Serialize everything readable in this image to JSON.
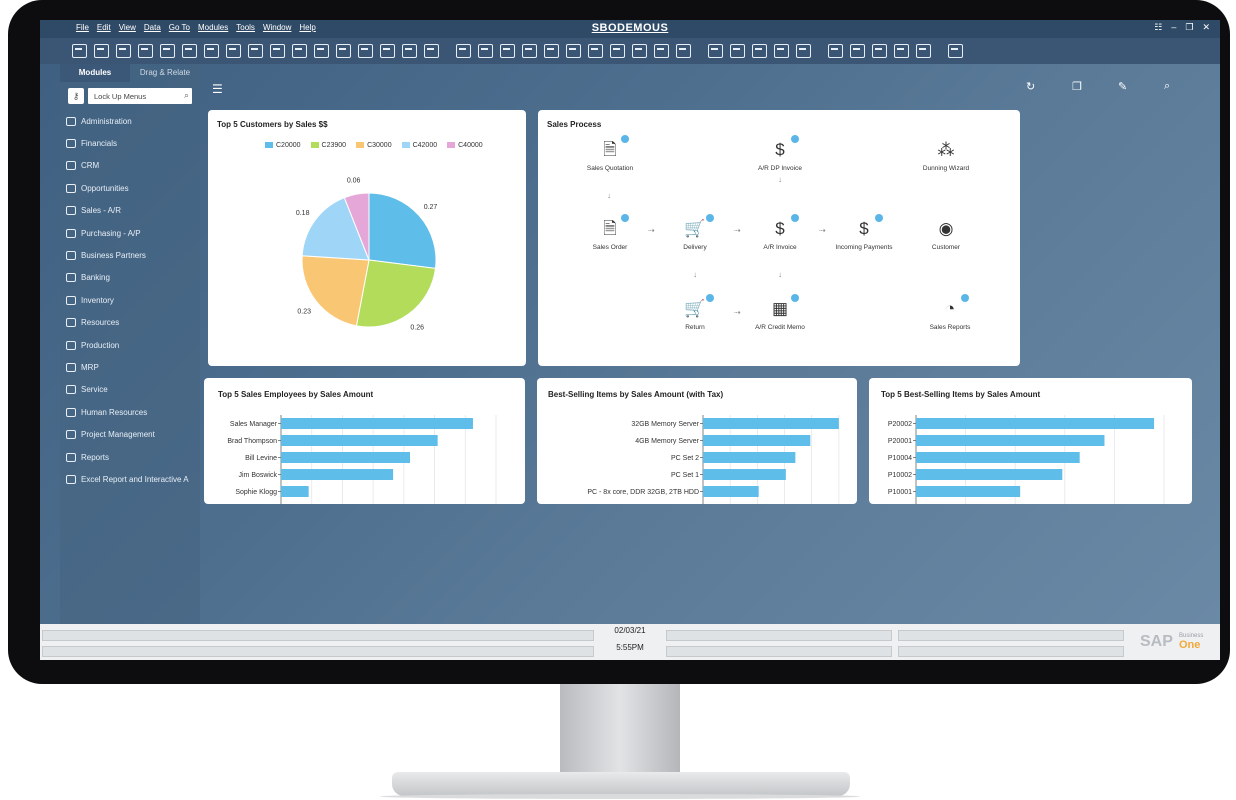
{
  "app": {
    "title": "SBODEMOUS",
    "menu": [
      "File",
      "Edit",
      "View",
      "Data",
      "Go To",
      "Modules",
      "Tools",
      "Window",
      "Help"
    ]
  },
  "sidebar": {
    "tabs": [
      "Modules",
      "Drag & Relate"
    ],
    "search_placeholder": "Lock Up Menus",
    "items": [
      "Administration",
      "Financials",
      "CRM",
      "Opportunities",
      "Sales - A/R",
      "Purchasing - A/P",
      "Business Partners",
      "Banking",
      "Inventory",
      "Resources",
      "Production",
      "MRP",
      "Service",
      "Human Resources",
      "Project Management",
      "Reports",
      "Excel Report and Interactive A"
    ]
  },
  "cards": {
    "pie_title": "Top 5 Customers by Sales $$",
    "process_title": "Sales Process",
    "emp_title": "Top 5 Sales Employees by Sales Amount",
    "items_tax_title": "Best-Selling Items by Sales Amount (with Tax)",
    "items_title": "Top 5 Best-Selling Items by Sales Amount"
  },
  "sales_process": [
    {
      "label": "Sales Quotation",
      "icon": "document-icon"
    },
    {
      "label": "A/R DP Invoice",
      "icon": "invoice-dollar-icon"
    },
    {
      "label": "Dunning Wizard",
      "icon": "dots-cluster-icon"
    },
    {
      "label": "Sales Order",
      "icon": "document-icon"
    },
    {
      "label": "Delivery",
      "icon": "cart-icon"
    },
    {
      "label": "A/R Invoice",
      "icon": "invoice-dollar-icon"
    },
    {
      "label": "Incoming Payments",
      "icon": "payment-icon"
    },
    {
      "label": "Customer",
      "icon": "user-icon"
    },
    {
      "label": "Return",
      "icon": "cart-return-icon"
    },
    {
      "label": "A/R Credit Memo",
      "icon": "credit-memo-icon"
    },
    {
      "label": "Sales Reports",
      "icon": "pie-report-icon"
    }
  ],
  "status": {
    "date": "02/03/21",
    "time": "5:55PM",
    "brand": "SAP",
    "brand_sub": "Business",
    "brand_one": "One"
  },
  "colors": {
    "bar": "#5fbde9",
    "pie": [
      "#5fbde9",
      "#b3dc5a",
      "#f9c773",
      "#9fd6f7",
      "#e5a7d8"
    ]
  },
  "chart_data": [
    {
      "type": "pie",
      "title": "Top 5 Customers by Sales $$",
      "categories": [
        "C20000",
        "C23900",
        "C30000",
        "C42000",
        "C40000"
      ],
      "values": [
        0.27,
        0.26,
        0.23,
        0.18,
        0.06
      ]
    },
    {
      "type": "bar",
      "orientation": "horizontal",
      "title": "Top 5 Sales Employees by Sales Amount",
      "categories": [
        "Sales Manager",
        "Brad Thompson",
        "Bill Levine",
        "Jim Boswick",
        "Sophie Klogg"
      ],
      "values": [
        12.5,
        10.2,
        8.4,
        7.3,
        1.8
      ],
      "xticks": [
        "0",
        "2M",
        "4M",
        "6M",
        "8M",
        "10M",
        "12M",
        "14M"
      ],
      "xlim": [
        0,
        14
      ],
      "unit": "M"
    },
    {
      "type": "bar",
      "orientation": "horizontal",
      "title": "Best-Selling Items by Sales Amount (with Tax)",
      "categories": [
        "32GB Memory Server",
        "4GB Memory Server",
        "PC Set 2",
        "PC Set 1",
        "PC - 8x core, DDR 32GB, 2TB HDD"
      ],
      "values": [
        5.0,
        3.95,
        3.4,
        3.05,
        2.05
      ],
      "xticks": [
        "0",
        "1M",
        "2M",
        "3M",
        "4M",
        "5M",
        "6M"
      ],
      "xlim": [
        0,
        6
      ],
      "unit": "M"
    },
    {
      "type": "bar",
      "orientation": "horizontal",
      "title": "Top 5 Best-Selling Items by Sales Amount",
      "categories": [
        "P20002",
        "P20001",
        "P10004",
        "P10002",
        "P10001"
      ],
      "values": [
        4.8,
        3.8,
        3.3,
        2.95,
        2.1
      ],
      "xticks": [
        "0",
        "1M",
        "2M",
        "3M",
        "4M",
        "5M"
      ],
      "xlim": [
        0,
        5
      ],
      "unit": "M"
    }
  ]
}
